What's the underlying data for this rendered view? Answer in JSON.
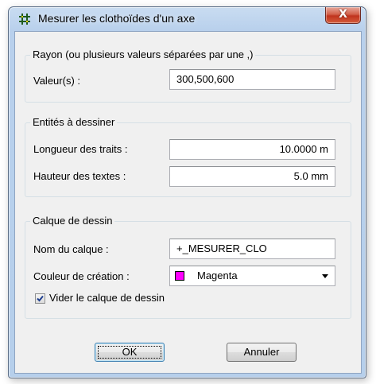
{
  "window": {
    "title": "Mesurer les clothoïdes d'un axe",
    "close_glyph": "X",
    "icon": "grid-app-icon"
  },
  "rayon": {
    "group_title": "Rayon (ou plusieurs valeurs séparées par une ,)",
    "label": "Valeur(s) :",
    "value": "300,500,600"
  },
  "entites": {
    "group_title": "Entités à dessiner",
    "longueur_label": "Longueur des traits :",
    "longueur_value": "10.0000 m",
    "hauteur_label": "Hauteur des textes :",
    "hauteur_value": "5.0 mm"
  },
  "calque": {
    "group_title": "Calque de dessin",
    "nom_label": "Nom du calque :",
    "nom_value": "+_MESURER_CLO",
    "couleur_label": "Couleur de création :",
    "couleur_value": "Magenta",
    "couleur_hex": "#ff00ff",
    "vider_label": "Vider le calque de dessin",
    "vider_checked": true
  },
  "buttons": {
    "ok": "OK",
    "cancel": "Annuler"
  }
}
